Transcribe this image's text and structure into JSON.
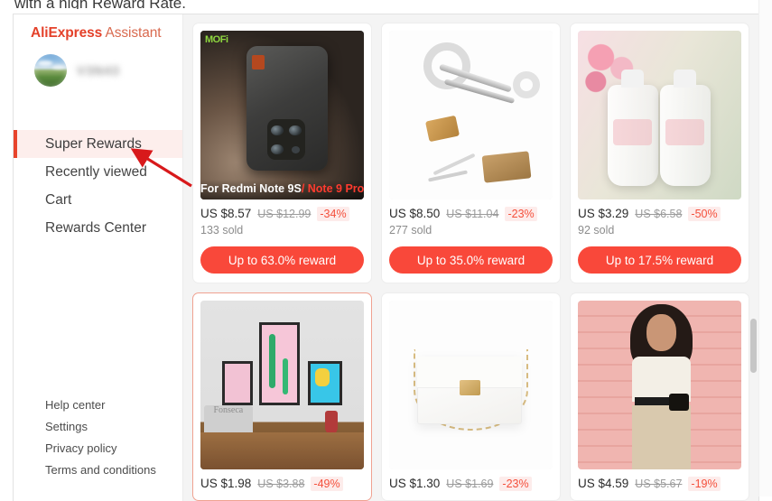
{
  "page": {
    "cutoff_heading": "with a high Reward Rate."
  },
  "sidebar": {
    "brand": {
      "part1": "Ali",
      "part2": "Express",
      "part3": " Assistant",
      "color": "#e4412a"
    },
    "user": {
      "avatar_name": "user-avatar-landscape",
      "username": "V3N43"
    },
    "nav_items": [
      {
        "label": "Super Rewards",
        "active": true
      },
      {
        "label": "Recently viewed",
        "active": false
      },
      {
        "label": "Cart",
        "active": false
      },
      {
        "label": "Rewards Center",
        "active": false
      }
    ],
    "footer_links": [
      {
        "label": "Help center"
      },
      {
        "label": "Settings"
      },
      {
        "label": "Privacy policy"
      },
      {
        "label": "Terms and conditions"
      }
    ],
    "active_indicator_color": "#e8442c",
    "active_bg_color": "#fdeeec"
  },
  "annotation": {
    "name": "red-arrow-pointing-to-super-rewards",
    "color": "#d8191b"
  },
  "products": [
    {
      "image_name": "phone-case-mofi",
      "image_brand": "MOFi",
      "image_caption_main": "For Redmi Note 9S",
      "image_caption_accent": "/ Note 9 Pro",
      "price": "US $8.57",
      "old_price": "US $12.99",
      "discount": "-34%",
      "sold": "133 sold",
      "reward_label": "Up to 63.0% reward",
      "highlighted": false
    },
    {
      "image_name": "dental-tool-kit",
      "price": "US $8.50",
      "old_price": "US $11.04",
      "discount": "-23%",
      "sold": "277 sold",
      "reward_label": "Up to 35.0% reward",
      "highlighted": false
    },
    {
      "image_name": "baby-bottles",
      "price": "US $3.29",
      "old_price": "US $6.58",
      "discount": "-50%",
      "sold": "92 sold",
      "reward_label": "Up to 17.5% reward",
      "highlighted": false
    },
    {
      "image_name": "wall-art-posters",
      "image_watermark": "Fonseca",
      "price": "US $1.98",
      "old_price": "US $3.88",
      "discount": "-49%",
      "sold": "",
      "reward_label": "",
      "highlighted": true
    },
    {
      "image_name": "white-chain-handbag",
      "price": "US $1.30",
      "old_price": "US $1.69",
      "discount": "-23%",
      "sold": "",
      "reward_label": "",
      "highlighted": false
    },
    {
      "image_name": "fashion-model-outfit",
      "price": "US $4.59",
      "old_price": "US $5.67",
      "discount": "-19%",
      "sold": "",
      "reward_label": "",
      "highlighted": false
    }
  ],
  "colors": {
    "reward_button": "#f9483a",
    "discount_text": "#f4503c",
    "highlight_border": "#f0a291"
  }
}
